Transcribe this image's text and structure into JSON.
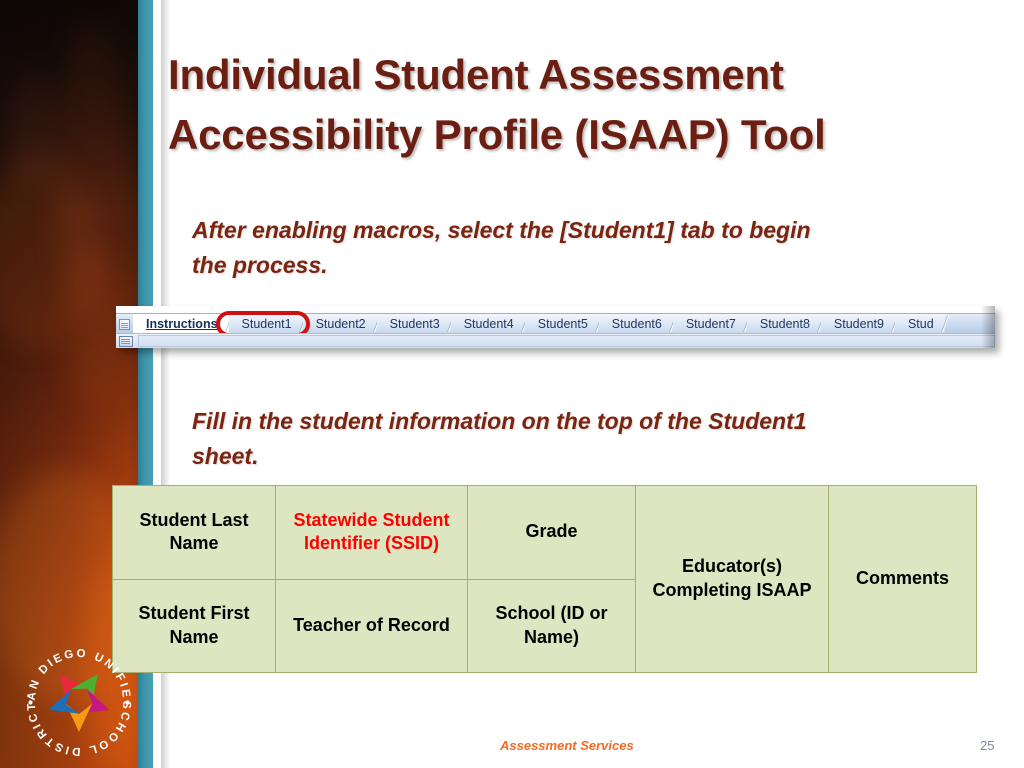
{
  "slide": {
    "title": "Individual Student Assessment Accessibility Profile (ISAAP) Tool",
    "instruction_1": "After enabling macros, select the [Student1] tab to begin the process.",
    "instruction_2": "Fill in the student information on the top of the Student1 sheet.",
    "accent_colors": {
      "title_maroon": "#6b1f12",
      "instruction_maroon": "#7b2410",
      "teal_stripe": "#3e93a9",
      "band_orange": "#c9500f",
      "table_green": "#dde6c0",
      "table_border": "#a8ae6e",
      "highlight_red": "#cc1111",
      "ssid_red": "#ff0000",
      "footer_orange": "#ef6c22",
      "page_number_gray": "#7b8a99"
    }
  },
  "excel": {
    "nav_icon": "sheet-nav-icon",
    "status_icon": "spreadsheet-icon",
    "clipped_text_1": "'' ''",
    "clipped_text_2": "'''''",
    "tabs": [
      {
        "label": "Instructions",
        "active": true,
        "highlighted": false
      },
      {
        "label": "Student1",
        "active": false,
        "highlighted": true
      },
      {
        "label": "Student2",
        "active": false,
        "highlighted": false
      },
      {
        "label": "Student3",
        "active": false,
        "highlighted": false
      },
      {
        "label": "Student4",
        "active": false,
        "highlighted": false
      },
      {
        "label": "Student5",
        "active": false,
        "highlighted": false
      },
      {
        "label": "Student6",
        "active": false,
        "highlighted": false
      },
      {
        "label": "Student7",
        "active": false,
        "highlighted": false
      },
      {
        "label": "Student8",
        "active": false,
        "highlighted": false
      },
      {
        "label": "Student9",
        "active": false,
        "highlighted": false
      },
      {
        "label": "Stud",
        "active": false,
        "highlighted": false
      }
    ]
  },
  "table": {
    "rows": [
      {
        "cells": [
          {
            "text": "Student Last Name",
            "red": false,
            "rowspan": 1
          },
          {
            "text": "Statewide Student Identifier (SSID)",
            "red": true,
            "rowspan": 1
          },
          {
            "text": "Grade",
            "red": false,
            "rowspan": 1
          },
          {
            "text": "Educator(s) Completing ISAAP",
            "red": false,
            "rowspan": 2
          },
          {
            "text": "Comments",
            "red": false,
            "rowspan": 2
          }
        ]
      },
      {
        "cells": [
          {
            "text": "Student First Name",
            "red": false,
            "rowspan": 1
          },
          {
            "text": "Teacher of Record",
            "red": false,
            "rowspan": 1
          },
          {
            "text": "School (ID or Name)",
            "red": false,
            "rowspan": 1
          }
        ]
      }
    ]
  },
  "logo": {
    "name": "san-diego-unified-school-district-logo",
    "top_text": "SAN DIEGO UNIFIED",
    "bottom_text": "SCHOOL DISTRICT",
    "petal_colors": [
      "#e8283c",
      "#4caf2f",
      "#c6197f",
      "#f59a12",
      "#1d6fb8"
    ]
  },
  "footer": {
    "label": "Assessment Services",
    "page_number": "25"
  }
}
